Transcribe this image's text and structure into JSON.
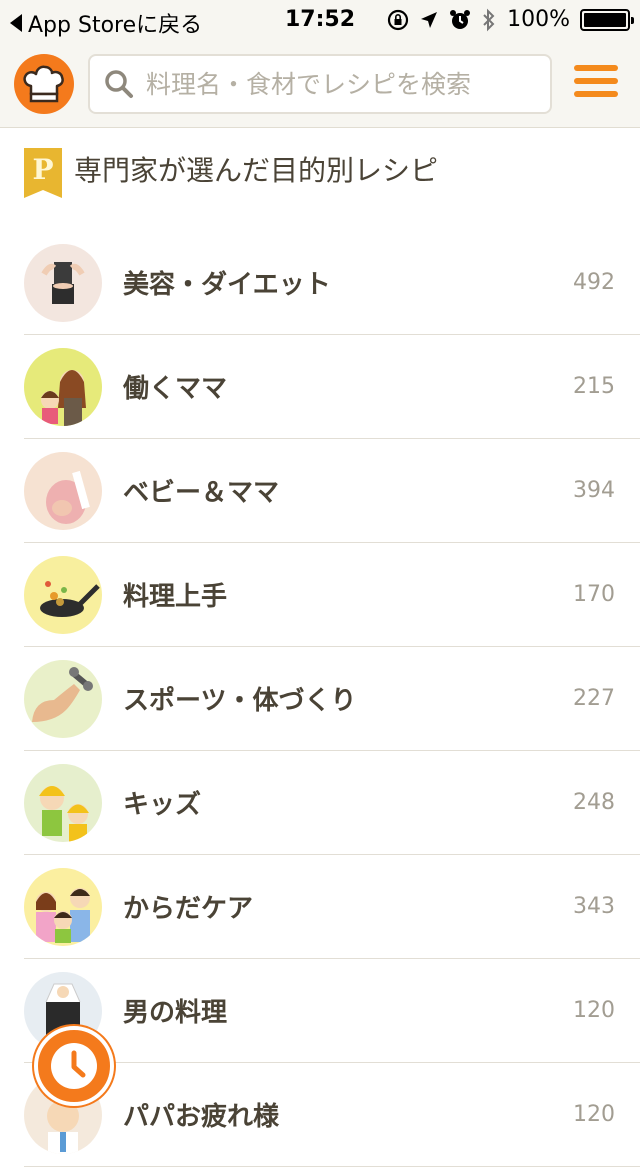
{
  "status_bar": {
    "back_label": "App Storeに戻る",
    "time": "17:52",
    "battery": "100%"
  },
  "header": {
    "search_placeholder": "料理名・食材でレシピを検索"
  },
  "section": {
    "badge": "P",
    "title": "専門家が選んだ目的別レシピ"
  },
  "categories": [
    {
      "label": "美容・ダイエット",
      "count": "492",
      "avatar_bg": "#f3e6df",
      "icon": "fitness-woman-icon"
    },
    {
      "label": "働くママ",
      "count": "215",
      "avatar_bg": "#e6ea7a",
      "icon": "working-mom-icon"
    },
    {
      "label": "ベビー＆ママ",
      "count": "394",
      "avatar_bg": "#f6e2d2",
      "icon": "pregnant-woman-icon"
    },
    {
      "label": "料理上手",
      "count": "170",
      "avatar_bg": "#f8ef9e",
      "icon": "frying-pan-icon"
    },
    {
      "label": "スポーツ・体づくり",
      "count": "227",
      "avatar_bg": "#e9f0c9",
      "icon": "muscle-dumbbell-icon"
    },
    {
      "label": "キッズ",
      "count": "248",
      "avatar_bg": "#e6efcd",
      "icon": "kids-icon"
    },
    {
      "label": "からだケア",
      "count": "343",
      "avatar_bg": "#fbefa0",
      "icon": "family-icon"
    },
    {
      "label": "男の料理",
      "count": "120",
      "avatar_bg": "#e7edf2",
      "icon": "man-apron-icon"
    },
    {
      "label": "パパお疲れ様",
      "count": "120",
      "avatar_bg": "#f4e9dc",
      "icon": "dad-icon"
    }
  ]
}
